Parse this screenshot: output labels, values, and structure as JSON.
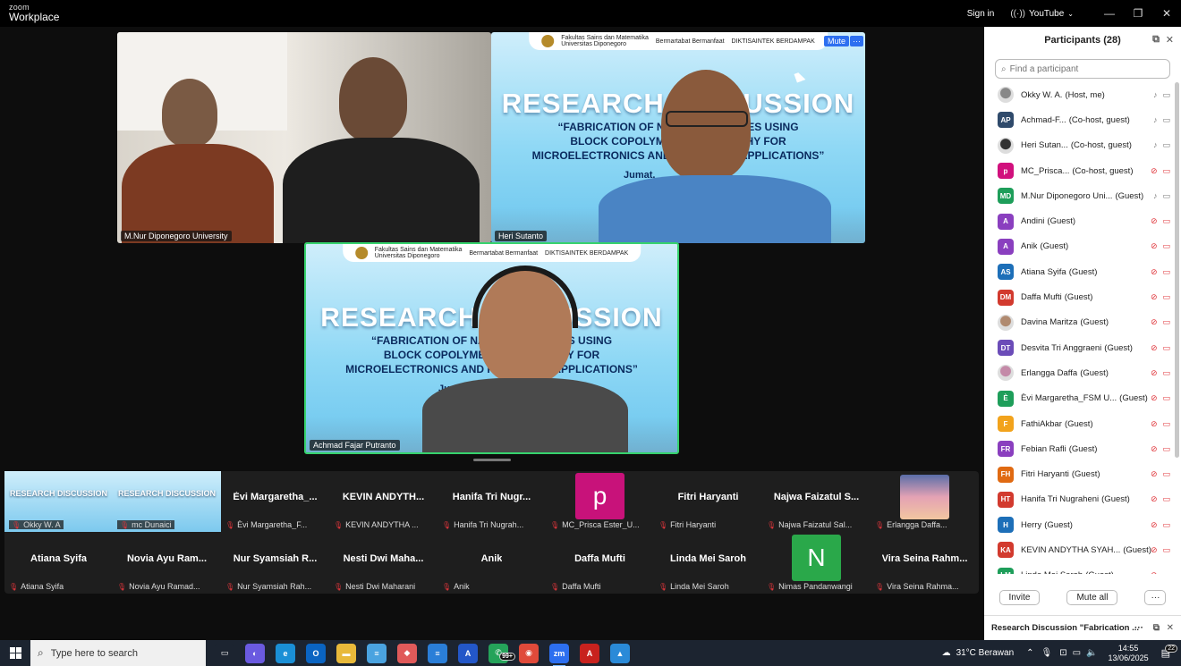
{
  "titlebar": {
    "logo_top": "zoom",
    "logo_bottom": "Workplace",
    "signin": "Sign in",
    "youtube": "YouTube",
    "icons": [
      "minimize-icon",
      "maximize-icon",
      "close-icon"
    ]
  },
  "stage": {
    "tile1_name": "M.Nur Diponegoro University",
    "tile2_name": "Heri Sutanto",
    "tile3_name": "Achmad Fajar Putranto",
    "mute_label": "Mute",
    "more_label": "···",
    "banner": {
      "faculty": "Fakultas Sains dan Matematika",
      "university": "Universitas Diponegoro",
      "tagline": "Bermartabat Bermanfaat",
      "partner": "DIKTISAINTEK BERDAMPAK",
      "title": "RESEARCH DISCUSSION",
      "subtitle_1": "“FABRICATION OF NANOSTRUCTURES USING",
      "subtitle_2": "BLOCK COPOLYMER LITHOGRAPHY FOR",
      "subtitle_3": "MICROELECTRONICS AND PHOTONICS APPLICATIONS”",
      "date": "Jumat,"
    }
  },
  "gallery": {
    "row1": [
      {
        "big": "",
        "foot": "Okky W. A",
        "video": true
      },
      {
        "big": "",
        "foot": "mc Dunaici",
        "video": true
      },
      {
        "big": "Èvi Margaretha_...",
        "foot": "Èvi Margaretha_F..."
      },
      {
        "big": "KEVIN ANDYTH...",
        "foot": "KEVIN ANDYTHA ..."
      },
      {
        "big": "Hanifa Tri Nugr...",
        "foot": "Hanifa Tri Nugrah..."
      },
      {
        "big": "p",
        "foot": "MC_Prisca Ester_U...",
        "avatar": true
      },
      {
        "big": "Fitri Haryanti",
        "foot": "Fitri Haryanti"
      },
      {
        "big": "Najwa Faizatul S...",
        "foot": "Najwa Faizatul Sal..."
      },
      {
        "big": "",
        "foot": "Erlangga Daffa...",
        "photo": true
      }
    ],
    "row2": [
      {
        "big": "Atiana Syifa",
        "foot": "Atiana Syifa"
      },
      {
        "big": "Novia Ayu Ram...",
        "foot": "Novia Ayu Ramad..."
      },
      {
        "big": "Nur Syamsiah R...",
        "foot": "Nur Syamsiah Rah..."
      },
      {
        "big": "Nesti Dwi Maha...",
        "foot": "Nesti Dwi Maharani"
      },
      {
        "big": "Anik",
        "foot": "Anik"
      },
      {
        "big": "Daffa Mufti",
        "foot": "Daffa Mufti"
      },
      {
        "big": "Linda Mei Saroh",
        "foot": "Linda Mei Saroh"
      },
      {
        "big": "N",
        "foot": "Nimas Pandanwangi",
        "avatar": true
      },
      {
        "big": "Vira Seina Rahm...",
        "foot": "Vira Seina Rahma..."
      }
    ]
  },
  "panel": {
    "title": "Participants (28)",
    "search_placeholder": "Find a participant",
    "participants": [
      {
        "av": "",
        "name": "Okky W. A.",
        "role": "(Host, me)",
        "color": "#888888",
        "photo": true,
        "state": "on"
      },
      {
        "av": "AP",
        "name": "Achmad-F...",
        "role": "(Co-host, guest)",
        "color": "#2f4a6b",
        "state": "on"
      },
      {
        "av": "",
        "name": "Heri Sutan...",
        "role": "(Co-host, guest)",
        "color": "#333333",
        "photo": true,
        "state": "on"
      },
      {
        "av": "p",
        "name": "MC_Prisca...",
        "role": "(Co-host, guest)",
        "color": "#d1107d",
        "state": "off"
      },
      {
        "av": "MD",
        "name": "M.Nur Diponegoro Uni...",
        "role": "(Guest)",
        "color": "#1e9e5a",
        "state": "on"
      },
      {
        "av": "A",
        "name": "Andini",
        "role": "(Guest)",
        "color": "#8a3fbf",
        "state": "off"
      },
      {
        "av": "A",
        "name": "Anik",
        "role": "(Guest)",
        "color": "#8a3fbf",
        "state": "off"
      },
      {
        "av": "AS",
        "name": "Atiana Syifa",
        "role": "(Guest)",
        "color": "#1d6fb8",
        "state": "off"
      },
      {
        "av": "DM",
        "name": "Daffa Mufti",
        "role": "(Guest)",
        "color": "#d23a2e",
        "state": "off"
      },
      {
        "av": "",
        "name": "Davina Maritza",
        "role": "(Guest)",
        "color": "#b08a70",
        "photo": true,
        "state": "off"
      },
      {
        "av": "DT",
        "name": "Desvita Tri Anggraeni",
        "role": "(Guest)",
        "color": "#6b4cb8",
        "state": "off"
      },
      {
        "av": "",
        "name": "Erlangga Daffa",
        "role": "(Guest)",
        "color": "#c48aa8",
        "photo": true,
        "state": "off"
      },
      {
        "av": "È",
        "name": "Èvi Margaretha_FSM U...",
        "role": "(Guest)",
        "color": "#1e9e5a",
        "state": "off"
      },
      {
        "av": "F",
        "name": "FathiAkbar",
        "role": "(Guest)",
        "color": "#f2a31c",
        "state": "off"
      },
      {
        "av": "FR",
        "name": "Febian Rafli",
        "role": "(Guest)",
        "color": "#8a3fbf",
        "state": "off"
      },
      {
        "av": "FH",
        "name": "Fitri Haryanti",
        "role": "(Guest)",
        "color": "#e06a12",
        "state": "off"
      },
      {
        "av": "HT",
        "name": "Hanifa Tri Nugraheni",
        "role": "(Guest)",
        "color": "#d23a2e",
        "state": "off"
      },
      {
        "av": "H",
        "name": "Herry",
        "role": "(Guest)",
        "color": "#1d6fb8",
        "state": "off"
      },
      {
        "av": "KA",
        "name": "KEVIN ANDYTHA SYAH...",
        "role": "(Guest)",
        "color": "#d23a2e",
        "state": "off"
      },
      {
        "av": "LM",
        "name": "Linda Mei Saroh",
        "role": "(Guest)",
        "color": "#1e9e5a",
        "state": "off"
      }
    ],
    "invite": "Invite",
    "mute_all": "Mute all",
    "more": "···",
    "chat_title": "Research Discussion \"Fabrication ..."
  },
  "taskbar": {
    "search_placeholder": "Type here to search",
    "weather": "31°C  Berawan",
    "time": "14:55",
    "date": "13/06/2025",
    "whatsapp_badge": "99+",
    "notif_count": "22",
    "apps": [
      {
        "name": "task-view-icon",
        "color": "#1c2430",
        "label": "▭"
      },
      {
        "name": "copilot-icon",
        "color": "#6a5ae0",
        "label": "◐"
      },
      {
        "name": "edge-icon",
        "color": "#1a8fd6",
        "label": "e"
      },
      {
        "name": "outlook-icon",
        "color": "#0a64c2",
        "label": "O"
      },
      {
        "name": "file-explorer-icon",
        "color": "#e8b93a",
        "label": "▬"
      },
      {
        "name": "notes-icon",
        "color": "#4aa3e0",
        "label": "≡"
      },
      {
        "name": "paint-icon",
        "color": "#e05a5a",
        "label": "◆"
      },
      {
        "name": "app-icon",
        "color": "#2a7ed8",
        "label": "≡"
      },
      {
        "name": "azure-icon",
        "color": "#2357c8",
        "label": "A"
      },
      {
        "name": "whatsapp-icon",
        "color": "#25a35a",
        "label": "✆"
      },
      {
        "name": "chrome-icon",
        "color": "#e04a3a",
        "label": "◉"
      },
      {
        "name": "zoom-icon",
        "color": "#2d6ff0",
        "label": "zm"
      },
      {
        "name": "acrobat-icon",
        "color": "#c8221e",
        "label": "A"
      },
      {
        "name": "photos-icon",
        "color": "#2a8ad8",
        "label": "▲"
      }
    ]
  }
}
